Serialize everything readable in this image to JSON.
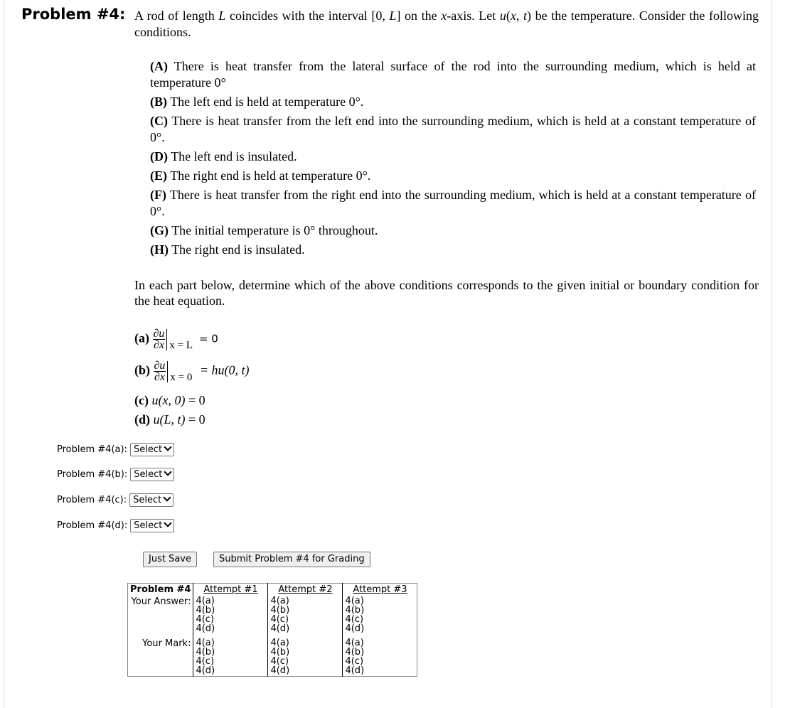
{
  "problem": {
    "title": "Problem #4:",
    "intro_parts": [
      "A rod of length ",
      "L",
      " coincides with the interval [0, ",
      "L",
      "] on the ",
      "x",
      "-axis. Let ",
      "u",
      "(",
      "x",
      ", ",
      "t",
      ") be the temperature. Consider the following conditions."
    ],
    "conditions": [
      {
        "label": "(A)",
        "text": "There is heat transfer from the lateral surface of the rod into the surrounding medium, which is held at temperature 0°"
      },
      {
        "label": "(B)",
        "text": "The left end is held at temperature 0°."
      },
      {
        "label": "(C)",
        "text": "There is heat transfer from the left end into the surrounding medium, which is held at a constant temperature of 0°."
      },
      {
        "label": "(D)",
        "text": "The left end is insulated."
      },
      {
        "label": "(E)",
        "text": "The right end is held at temperature 0°."
      },
      {
        "label": "(F)",
        "text": "There is heat transfer from the right end into the surrounding medium, which is held at a constant temperature of 0°."
      },
      {
        "label": "(G)",
        "text": "The initial temperature is 0° throughout."
      },
      {
        "label": "(H)",
        "text": "The right end is insulated."
      }
    ],
    "instructions": "In each part below, determine which of the above conditions corresponds to the given initial or boundary condition for the heat equation.",
    "parts": [
      {
        "label": "(a)",
        "num": "∂u",
        "den": "∂x",
        "eval": "x = L",
        "rhs": "= 0"
      },
      {
        "label": "(b)",
        "num": "∂u",
        "den": "∂x",
        "eval": "x = 0",
        "rhs": "= hu(0, t)"
      },
      {
        "label": "(c)",
        "lhs": "u(x, 0)",
        "rhs": "= 0"
      },
      {
        "label": "(d)",
        "lhs": "u(L, t)",
        "rhs": "= 0"
      }
    ]
  },
  "answers": [
    {
      "label": "Problem #4(a):",
      "value": "Select"
    },
    {
      "label": "Problem #4(b):",
      "value": "Select"
    },
    {
      "label": "Problem #4(c):",
      "value": "Select"
    },
    {
      "label": "Problem #4(d):",
      "value": "Select"
    }
  ],
  "buttons": {
    "save": "Just Save",
    "submit": "Submit Problem #4 for Grading"
  },
  "history": {
    "header": "Problem #4",
    "attempts": [
      "Attempt #1",
      "Attempt #2",
      "Attempt #3"
    ],
    "answer_label": "Your Answer:",
    "mark_label": "Your Mark:",
    "items": [
      "4(a)",
      "4(b)",
      "4(c)",
      "4(d)"
    ]
  }
}
